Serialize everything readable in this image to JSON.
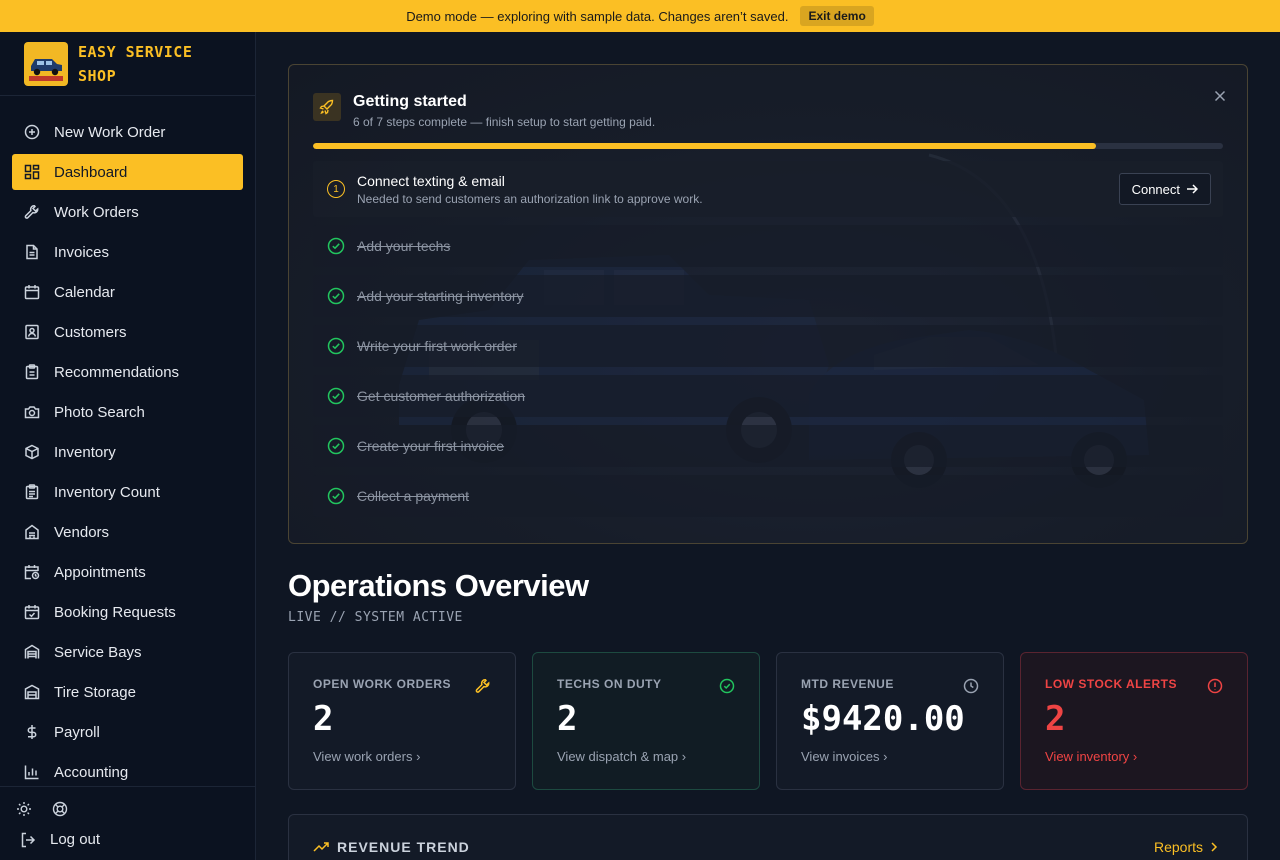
{
  "banner": {
    "message": "Demo mode — exploring with sample data. Changes aren’t saved.",
    "exit_label": "Exit demo"
  },
  "brand": {
    "line1": "EASY SERVICE",
    "line2": "SHOP"
  },
  "nav": [
    {
      "label": "New Work Order",
      "icon": "plus-circle-icon"
    },
    {
      "label": "Dashboard",
      "icon": "dashboard-icon",
      "active": true
    },
    {
      "label": "Work Orders",
      "icon": "wrench-icon"
    },
    {
      "label": "Invoices",
      "icon": "file-icon"
    },
    {
      "label": "Calendar",
      "icon": "calendar-icon"
    },
    {
      "label": "Customers",
      "icon": "contact-icon"
    },
    {
      "label": "Recommendations",
      "icon": "clipboard-icon"
    },
    {
      "label": "Photo Search",
      "icon": "camera-icon"
    },
    {
      "label": "Inventory",
      "icon": "package-icon"
    },
    {
      "label": "Inventory Count",
      "icon": "clipboard-list-icon"
    },
    {
      "label": "Vendors",
      "icon": "building-icon"
    },
    {
      "label": "Appointments",
      "icon": "calendar-clock-icon"
    },
    {
      "label": "Booking Requests",
      "icon": "calendar-check-icon"
    },
    {
      "label": "Service Bays",
      "icon": "warehouse-icon"
    },
    {
      "label": "Tire Storage",
      "icon": "storage-icon"
    },
    {
      "label": "Payroll",
      "icon": "dollar-icon"
    },
    {
      "label": "Accounting",
      "icon": "bar-chart-icon"
    }
  ],
  "footer": {
    "logout_label": "Log out"
  },
  "getting_started": {
    "title": "Getting started",
    "subtitle": "6 of 7 steps complete — finish setup to start getting paid.",
    "progress": 0.86,
    "current_step": {
      "number": "1",
      "title": "Connect texting & email",
      "description": "Needed to send customers an authorization link to approve work.",
      "button_label": "Connect"
    },
    "completed_steps": [
      "Add your techs",
      "Add your starting inventory",
      "Write your first work order",
      "Get customer authorization",
      "Create your first invoice",
      "Collect a payment"
    ]
  },
  "overview": {
    "title": "Operations Overview",
    "subtitle": "LIVE // SYSTEM ACTIVE"
  },
  "stats": [
    {
      "label": "OPEN WORK ORDERS",
      "value": "2",
      "link": "View work orders",
      "icon": "wrench-icon",
      "color": "#fbbf24"
    },
    {
      "label": "TECHS ON DUTY",
      "value": "2",
      "link": "View dispatch & map",
      "icon": "check-circle-icon",
      "color": "#22c55e"
    },
    {
      "label": "MTD REVENUE",
      "value": "$9420.00",
      "link": "View invoices",
      "icon": "clock-icon",
      "color": "#9aa3b2"
    },
    {
      "label": "LOW STOCK ALERTS",
      "value": "2",
      "link": "View inventory",
      "icon": "alert-circle-icon",
      "color": "#ef4444"
    }
  ],
  "trend": {
    "title": "REVENUE TREND",
    "reports_label": "Reports"
  },
  "colors": {
    "accent": "#fbbf24",
    "success": "#22c55e",
    "danger": "#ef4444",
    "background": "#0f1623"
  }
}
